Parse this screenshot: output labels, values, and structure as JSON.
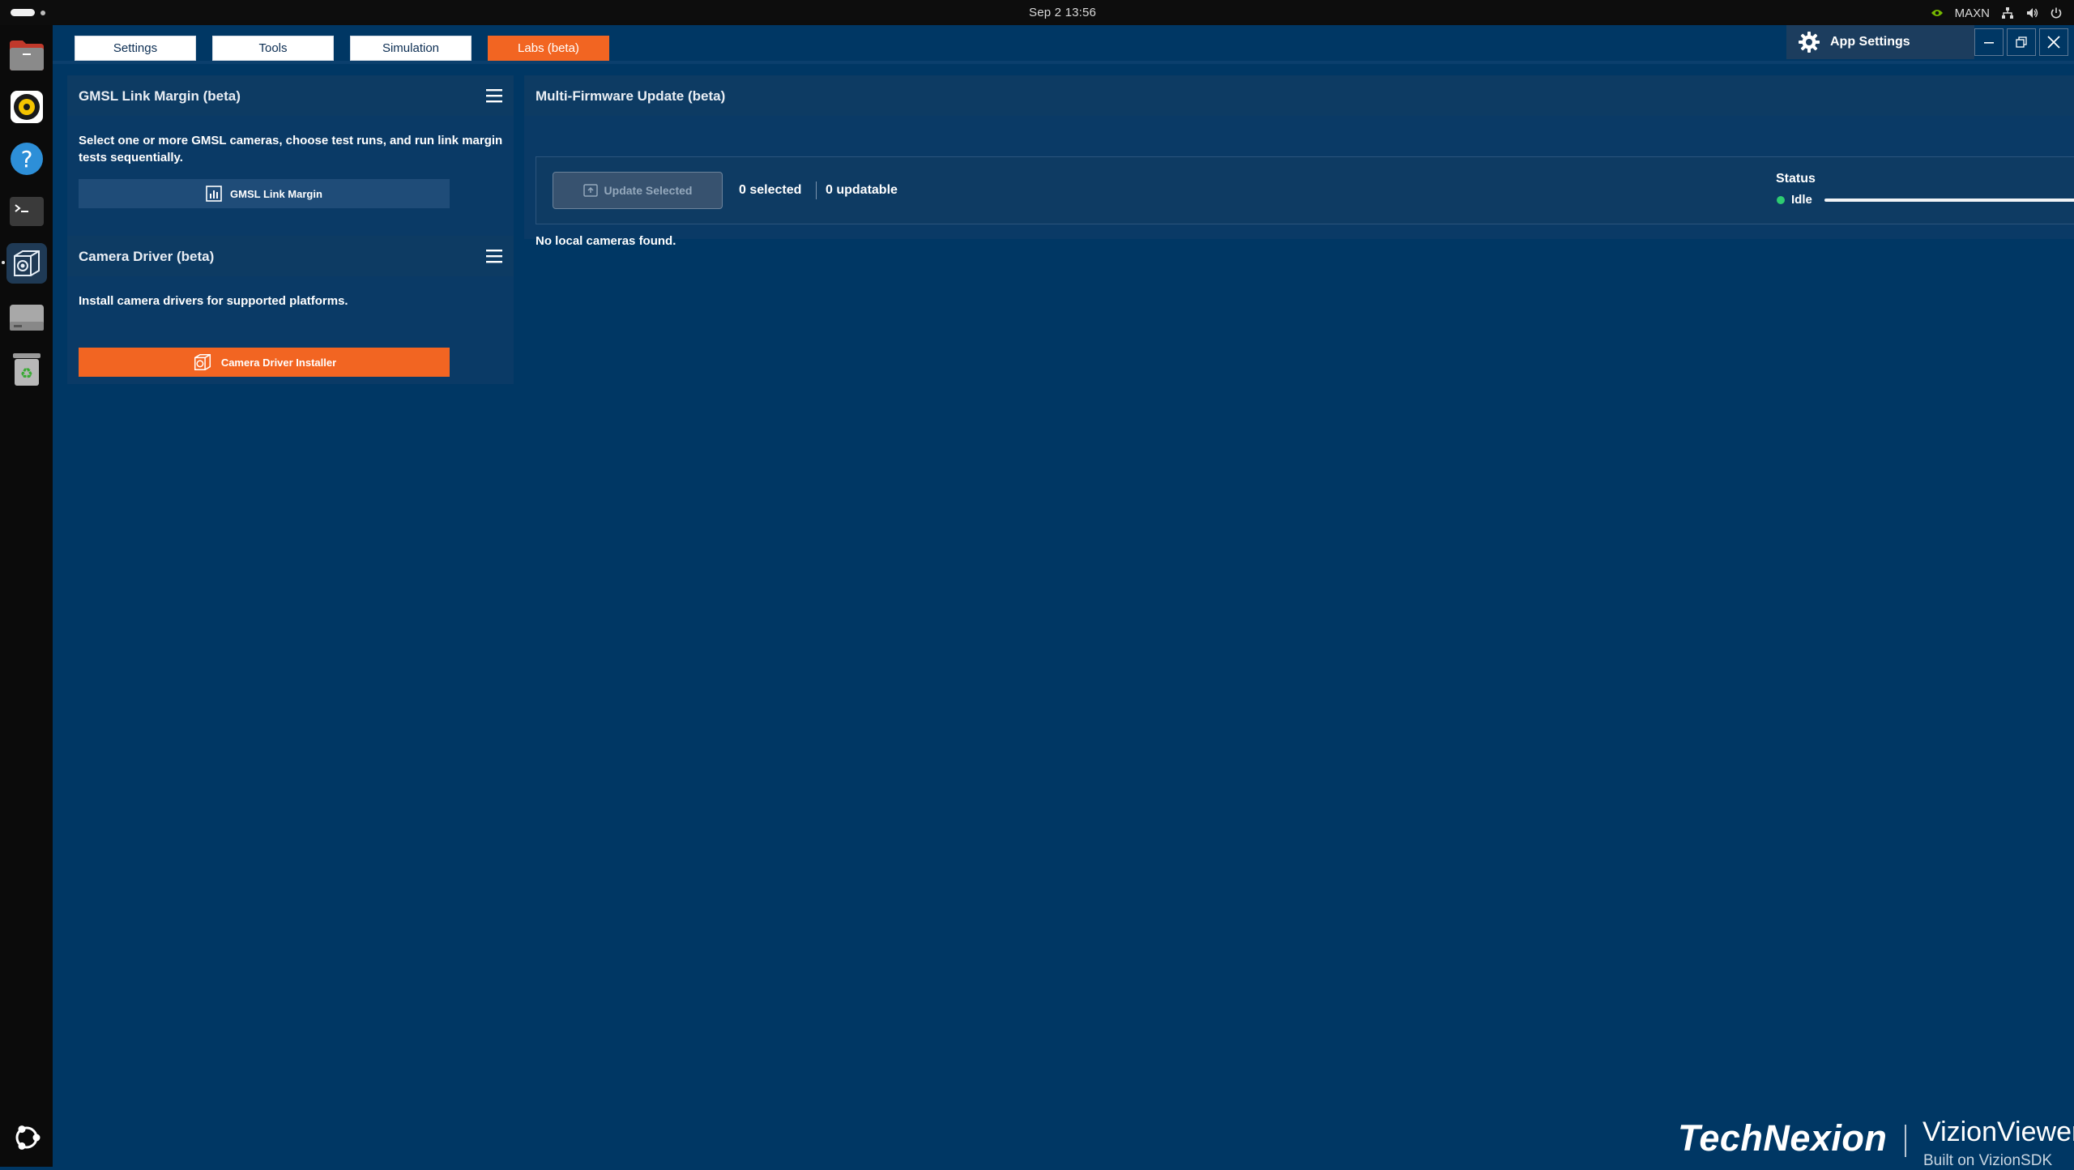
{
  "system_bar": {
    "clock": "Sep 2  13:56",
    "power_mode": "MAXN"
  },
  "dock": {
    "items": [
      {
        "name": "files-icon"
      },
      {
        "name": "rhythmbox-icon"
      },
      {
        "name": "help-icon"
      },
      {
        "name": "terminal-icon"
      },
      {
        "name": "vizionviewer-icon"
      },
      {
        "name": "drive-icon"
      },
      {
        "name": "trash-icon"
      }
    ]
  },
  "tabs": [
    {
      "label": "Settings",
      "active": false
    },
    {
      "label": "Tools",
      "active": false
    },
    {
      "label": "Simulation",
      "active": false
    },
    {
      "label": "Labs (beta)",
      "active": true
    }
  ],
  "header": {
    "app_settings_label": "App Settings"
  },
  "gmsl_panel": {
    "title": "GMSL Link Margin (beta)",
    "description": "Select one or more GMSL cameras, choose test runs, and run link margin tests sequentially.",
    "button_label": "GMSL Link Margin"
  },
  "driver_panel": {
    "title": "Camera Driver (beta)",
    "description": "Install camera drivers for supported platforms.",
    "button_label": "Camera Driver Installer"
  },
  "firmware_panel": {
    "title": "Multi-Firmware Update (beta)",
    "update_button_label": "Update Selected",
    "selected_count": "0 selected",
    "updatable_count": "0 updatable",
    "status_label": "Status",
    "status_value": "Idle",
    "progress": 1.0,
    "empty_message": "No local cameras found."
  },
  "branding": {
    "company": "TechNexion",
    "product": "VizionViewer",
    "trademark": "™",
    "tagline": "Built on VizionSDK"
  },
  "colors": {
    "background": "#003764",
    "accent_orange": "#f26522",
    "status_ok": "#2ecc71"
  }
}
